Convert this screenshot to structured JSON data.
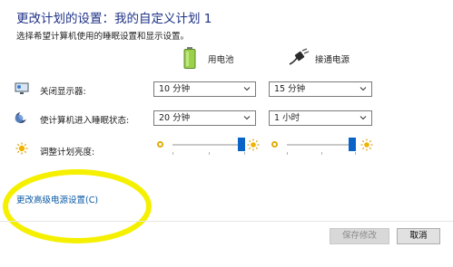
{
  "header": {
    "title": "更改计划的设置：我的自定义计划 1",
    "subtitle": "选择希望计算机使用的睡眠设置和显示设置。"
  },
  "columns": {
    "battery": {
      "label": "用电池",
      "icon": "battery-icon"
    },
    "plugged": {
      "label": "接通电源",
      "icon": "power-plug-icon"
    }
  },
  "rows": [
    {
      "label": "关闭显示器:",
      "icon": "monitor-icon",
      "battery_value": "10 分钟",
      "plugged_value": "15 分钟"
    },
    {
      "label": "使计算机进入睡眠状态:",
      "icon": "moon-icon",
      "battery_value": "20 分钟",
      "plugged_value": "1 小时"
    },
    {
      "label": "调整计划亮度:",
      "icon": "brightness-icon",
      "battery_level": 1.0,
      "plugged_level": 1.0
    }
  ],
  "link": {
    "label": "更改高级电源设置(C)"
  },
  "buttons": {
    "save": "保存修改",
    "cancel": "取消"
  },
  "colors": {
    "title": "#1e3287",
    "link": "#0a58a6",
    "accent": "#0a64c8",
    "highlight": "#f5f000"
  }
}
